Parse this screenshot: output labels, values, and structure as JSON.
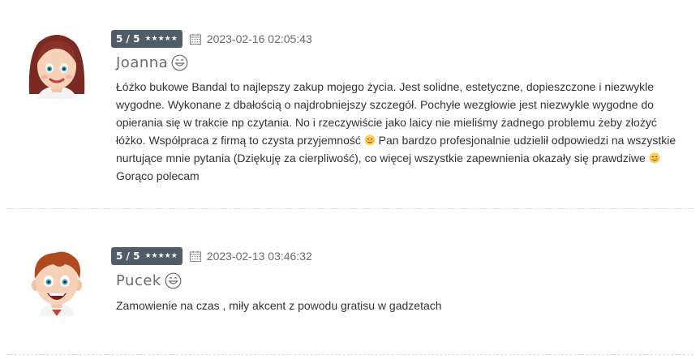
{
  "reviews": [
    {
      "rating_text": "5 / 5",
      "stars": "★★★★★",
      "stars_value": 5,
      "date": "2023-02-16 02:05:43",
      "name": "Joanna",
      "avatar_icon": "female-avatar-icon",
      "text_part1": "Łóżko bukowe Bandal to najlepszy zakup mojego życia. Jest solidne, estetyczne, dopieszczone i niezwykle wygodne. Wykonane z dbałością o najdrobniejszy szczegół. Pochyłe wezgłowie jest niezwykle wygodne do opierania się w trakcie np czytania. No i rzeczywiście jako laicy nie mieliśmy żadnego problemu żeby złożyć łóżko. Współpraca z firmą to czysta przyjemność ",
      "text_part2": " Pan bardzo profesjonalnie udzielił odpowiedzi na wszystkie nurtujące mnie pytania (Dziękuję za cierpliwość), co więcej wszystkie zapewnienia okazały się prawdziwe ",
      "text_part3": " Gorąco polecam"
    },
    {
      "rating_text": "5 / 5",
      "stars": "★★★★★",
      "stars_value": 5,
      "date": "2023-02-13 03:46:32",
      "name": "Pucek",
      "avatar_icon": "male-avatar-icon",
      "text": "Zamowienie na czas , miły akcent z powodu gratisu w gadzetach"
    }
  ],
  "colors": {
    "badge_bg": "#4f5d6b",
    "name_text": "#6b6b6b",
    "body_text": "#333333",
    "divider": "#dcdcdc"
  }
}
